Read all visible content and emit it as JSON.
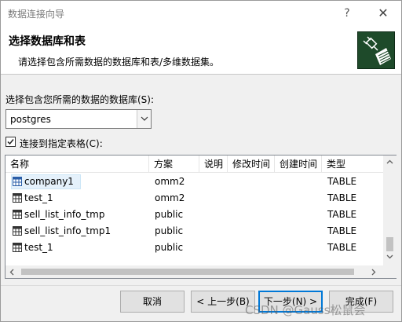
{
  "window": {
    "title": "数据连接向导",
    "help_glyph": "?",
    "close_glyph": "✕"
  },
  "header": {
    "heading": "选择数据库和表",
    "subheading": "请选择包含所需数据的数据库和表/多维数据集。"
  },
  "database": {
    "label": "选择包含您所需的数据的数据库(S):",
    "selected": "postgres"
  },
  "connect_table": {
    "label": "连接到指定表格(C):",
    "checked": true
  },
  "table_list": {
    "columns": [
      "名称",
      "方案",
      "说明",
      "修改时间",
      "创建时间",
      "类型"
    ],
    "rows": [
      {
        "name": "company1",
        "schema": "omm2",
        "description": "",
        "modified": "",
        "created": "",
        "type": "TABLE"
      },
      {
        "name": "test_1",
        "schema": "omm2",
        "description": "",
        "modified": "",
        "created": "",
        "type": "TABLE"
      },
      {
        "name": "sell_list_info_tmp",
        "schema": "public",
        "description": "",
        "modified": "",
        "created": "",
        "type": "TABLE"
      },
      {
        "name": "sell_list_info_tmp1",
        "schema": "public",
        "description": "",
        "modified": "",
        "created": "",
        "type": "TABLE"
      },
      {
        "name": "test_1",
        "schema": "public",
        "description": "",
        "modified": "",
        "created": "",
        "type": "TABLE"
      }
    ]
  },
  "buttons": {
    "cancel": "取消",
    "back": "< 上一步(B)",
    "next": "下一步(N) >",
    "finish": "完成(F)"
  },
  "watermark": "CSDN @Gauss松鼠会",
  "colors": {
    "header_bg": "#ffffff",
    "window_bg": "#f0f0f0",
    "selection": "#e5f1fb",
    "icon_green": "#1e4a2a"
  }
}
